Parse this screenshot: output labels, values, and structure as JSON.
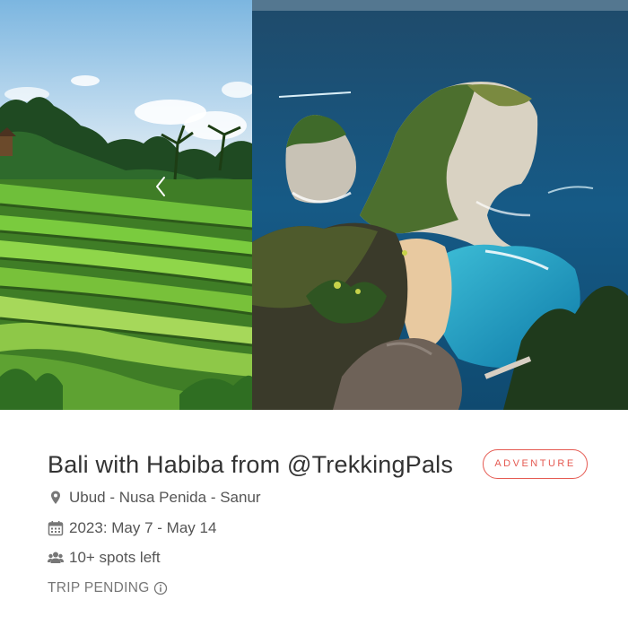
{
  "gallery": {
    "left_image": "rice-terraces-photo",
    "right_image": "coastal-cliffs-photo",
    "prev_icon": "chevron-left-icon"
  },
  "trip": {
    "title": "Bali with Habiba from @TrekkingPals",
    "tag": "ADVENTURE",
    "location": "Ubud - Nusa Penida - Sanur",
    "location_icon": "map-pin-icon",
    "dates": "2023: May 7 - May 14",
    "dates_icon": "calendar-icon",
    "spots": "10+ spots left",
    "spots_icon": "users-icon",
    "status": "TRIP PENDING",
    "status_icon": "info-icon"
  },
  "colors": {
    "accent": "#e55a52",
    "title": "#333333",
    "text": "#555555",
    "muted": "#777777"
  }
}
